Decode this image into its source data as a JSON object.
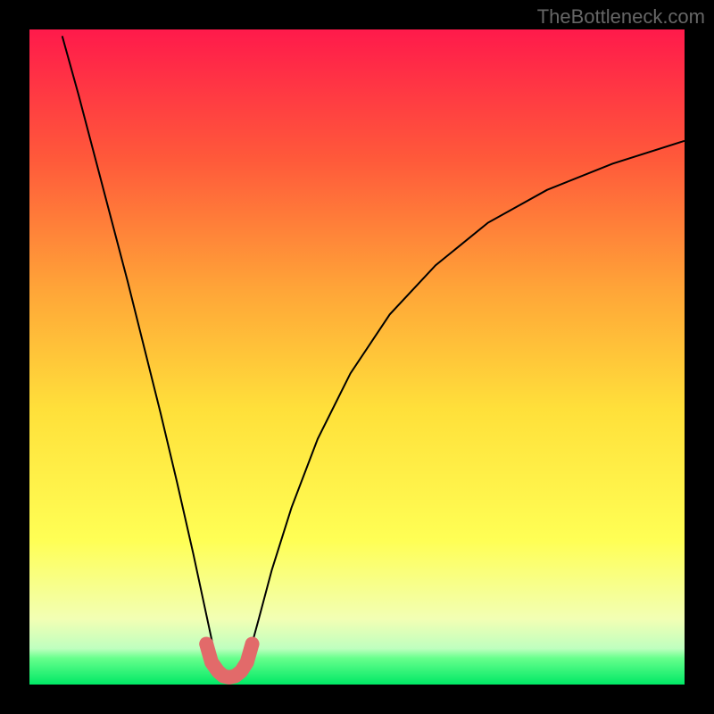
{
  "watermark": "TheBottleneck.com",
  "chart_data": {
    "type": "line",
    "title": "",
    "xlabel": "",
    "ylabel": "",
    "xlim": [
      0,
      100
    ],
    "ylim": [
      0,
      100
    ],
    "grid": false,
    "legend": false,
    "background_gradient": {
      "stops": [
        {
          "pos": 0.0,
          "color": "#ff1a4b"
        },
        {
          "pos": 0.2,
          "color": "#ff5a3a"
        },
        {
          "pos": 0.4,
          "color": "#ffa638"
        },
        {
          "pos": 0.58,
          "color": "#ffe03a"
        },
        {
          "pos": 0.78,
          "color": "#ffff55"
        },
        {
          "pos": 0.9,
          "color": "#f2ffb4"
        },
        {
          "pos": 0.945,
          "color": "#bfffbf"
        },
        {
          "pos": 0.96,
          "color": "#66ff8c"
        },
        {
          "pos": 1.0,
          "color": "#00e865"
        }
      ]
    },
    "series": [
      {
        "name": "bottleneck-curve",
        "color": "#000000",
        "stroke_width": 2,
        "x": [
          5.0,
          7.5,
          10.0,
          12.5,
          15.0,
          17.5,
          20.0,
          22.5,
          25.0,
          26.5,
          28.0,
          29.0,
          30.5,
          32.0,
          33.5,
          35.0,
          37.0,
          40.0,
          44.0,
          49.0,
          55.0,
          62.0,
          70.0,
          79.0,
          89.0,
          100.0
        ],
        "y": [
          99.0,
          90.0,
          80.5,
          71.0,
          61.5,
          51.5,
          41.5,
          31.0,
          20.0,
          13.0,
          6.0,
          2.0,
          0.5,
          1.0,
          4.5,
          10.0,
          17.5,
          27.0,
          37.5,
          47.5,
          56.5,
          64.0,
          70.5,
          75.5,
          79.5,
          83.0
        ]
      },
      {
        "name": "optimal-zone-marker",
        "color": "#e26a6a",
        "stroke_width": 16,
        "linecap": "round",
        "x": [
          27.0,
          27.8,
          28.8,
          29.6,
          30.5,
          31.4,
          32.3,
          33.2,
          34.0
        ],
        "y": [
          6.2,
          3.4,
          2.0,
          1.3,
          1.1,
          1.3,
          2.0,
          3.4,
          6.2
        ]
      }
    ]
  }
}
